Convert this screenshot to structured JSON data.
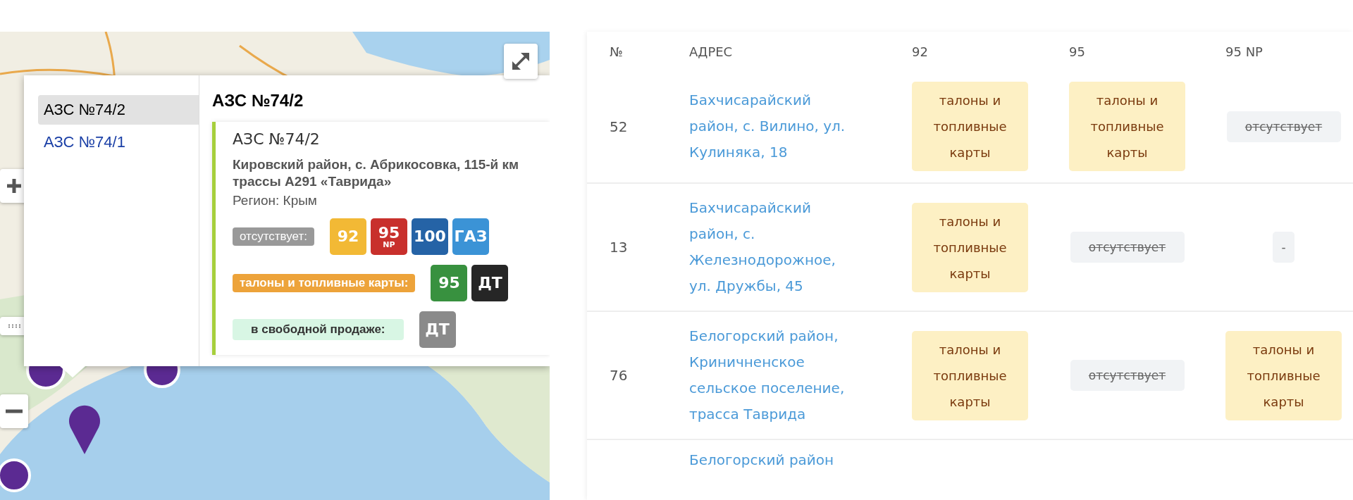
{
  "map": {
    "popup": {
      "list": [
        {
          "label": "АЗС №74/2",
          "selected": true
        },
        {
          "label": "АЗС №74/1",
          "selected": false
        }
      ],
      "title": "АЗС №74/2",
      "station": {
        "name": "АЗС №74/2",
        "address": "Кировский район, с. Абрикосовка, 115-й км трассы А291 «Таврида»",
        "region": "Регион: Крым",
        "groups": [
          {
            "kind": "absent",
            "label": "отсутствует:",
            "fuels": [
              {
                "label": "92",
                "color": "#f2b935"
              },
              {
                "label": "95",
                "sub": "NP",
                "color": "#c8302c"
              },
              {
                "label": "100",
                "color": "#2563a6"
              },
              {
                "label": "ГАЗ",
                "color": "#3b93d6"
              }
            ]
          },
          {
            "kind": "coupons",
            "label": "талоны и топливные карты:",
            "fuels": [
              {
                "label": "95",
                "color": "#38913f"
              },
              {
                "label": "ДТ",
                "color": "#262626"
              }
            ]
          },
          {
            "kind": "free",
            "label": "в свободной продаже:",
            "fuels": [
              {
                "label": "ДТ",
                "color": "#8a8a8a"
              }
            ]
          }
        ]
      }
    }
  },
  "table": {
    "columns": [
      "№",
      "АДРЕС",
      "92",
      "95",
      "95 NP"
    ],
    "rows": [
      {
        "number": "52",
        "address": "Бахчисарайский район, с. Вилино, ул. Кулиняка, 18",
        "cells": [
          {
            "kind": "coupons",
            "text": "талоны и топливные карты"
          },
          {
            "kind": "coupons",
            "text": "талоны и топливные карты"
          },
          {
            "kind": "absent",
            "text": "отсутствует"
          }
        ]
      },
      {
        "number": "13",
        "address": "Бахчисарайский район, с. Железнодорожное, ул. Дружбы, 45",
        "cells": [
          {
            "kind": "coupons",
            "text": "талоны и топливные карты"
          },
          {
            "kind": "absent",
            "text": "отсутствует"
          },
          {
            "kind": "none",
            "text": "-"
          }
        ]
      },
      {
        "number": "76",
        "address": "Белогорский район, Криничненское сельское поселение, трасса Таврида",
        "cells": [
          {
            "kind": "coupons",
            "text": "талоны и топливные карты"
          },
          {
            "kind": "absent",
            "text": "отсутствует"
          },
          {
            "kind": "coupons",
            "text": "талоны и топливные карты"
          }
        ]
      },
      {
        "address": "Белогорский район"
      }
    ]
  }
}
